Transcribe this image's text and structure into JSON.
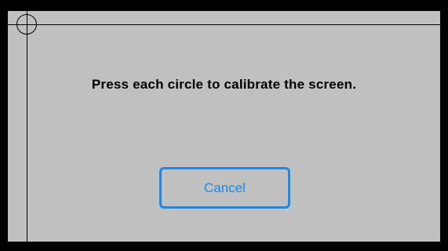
{
  "calibration": {
    "instruction": "Press each circle to calibrate the screen.",
    "cancel_label": "Cancel"
  },
  "colors": {
    "screen_background": "#c0c0c0",
    "frame": "#000000",
    "accent": "#1e88e5",
    "text": "#000000"
  },
  "icons": {
    "target": "calibration-target-icon"
  }
}
